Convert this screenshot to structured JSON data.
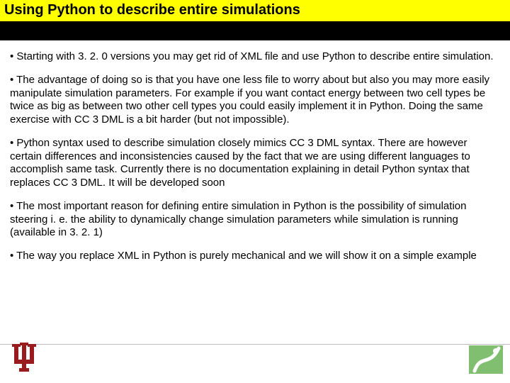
{
  "slide": {
    "title": "Using Python to describe entire simulations",
    "bullets": [
      "• Starting with 3. 2. 0 versions you may get rid of XML file and use Python to describe entire simulation.",
      "• The advantage of doing so is that you have one less file to worry about but also you may more easily manipulate simulation parameters. For example if you want contact energy between two cell types be twice as big as between two other cell types you could easily implement it in Python. Doing the same exercise with CC 3 DML is a bit harder (but not impossible).",
      "• Python syntax used to describe simulation closely mimics CC 3 DML syntax. There are however certain differences and inconsistencies caused by the fact that we are using different languages to accomplish same task. Currently there is no documentation explaining in detail Python syntax that replaces CC 3 DML. It will be developed soon",
      "• The most important reason for defining entire simulation in Python is the possibility of simulation steering i. e. the ability to dynamically change simulation parameters while simulation is running (available in 3. 2. 1)",
      "•  The way you replace XML in Python is purely mechanical and we will show it on a simple example"
    ],
    "logos": {
      "left_name": "iu-trident-logo",
      "right_name": "compucell3d-logo"
    },
    "colors": {
      "title_bg": "#ffff00",
      "strip": "#000000"
    }
  }
}
